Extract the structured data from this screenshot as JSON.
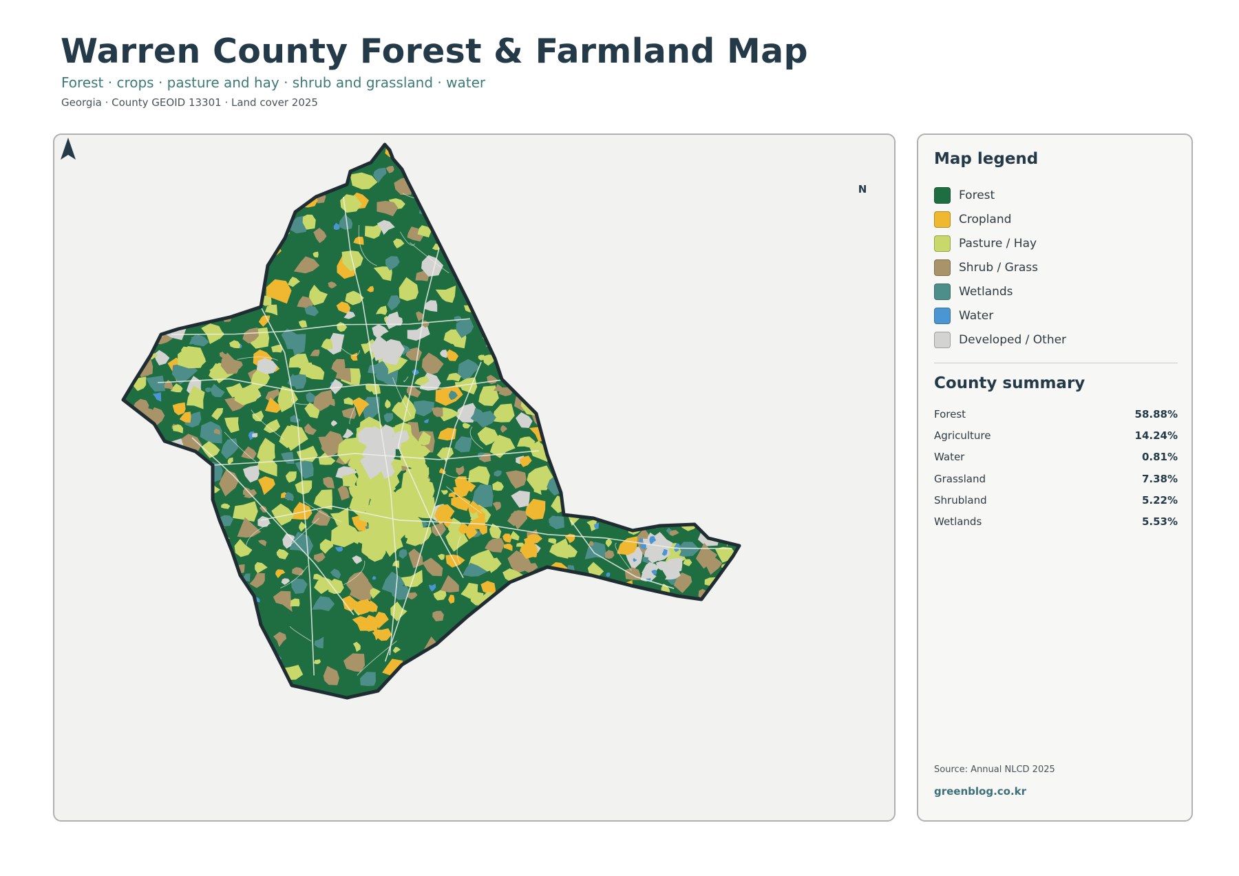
{
  "header": {
    "title": "Warren County Forest & Farmland Map",
    "subtitle": "Forest · crops · pasture and hay · shrub and grassland · water",
    "meta": "Georgia · County GEOID 13301 · Land cover 2025"
  },
  "map": {
    "north_label": "N",
    "colors": {
      "forest": "#1f6e42",
      "cropland": "#f0b731",
      "pasture": "#c9d86b",
      "shrub_grass": "#a99368",
      "wetlands": "#4e8e8a",
      "water": "#4b95d3",
      "developed": "#d3d3d1",
      "outline": "#1f2d33",
      "road": "#eef0ea"
    }
  },
  "legend": {
    "heading": "Map legend",
    "items": [
      {
        "label": "Forest",
        "color": "#1f6e42"
      },
      {
        "label": "Cropland",
        "color": "#f0b731"
      },
      {
        "label": "Pasture / Hay",
        "color": "#c9d86b"
      },
      {
        "label": "Shrub / Grass",
        "color": "#a99368"
      },
      {
        "label": "Wetlands",
        "color": "#4e8e8a"
      },
      {
        "label": "Water",
        "color": "#4b95d3"
      },
      {
        "label": "Developed / Other",
        "color": "#d3d3d1"
      }
    ]
  },
  "summary": {
    "heading": "County summary",
    "rows": [
      {
        "label": "Forest",
        "value": "58.88%"
      },
      {
        "label": "Agriculture",
        "value": "14.24%"
      },
      {
        "label": "Water",
        "value": "0.81%"
      },
      {
        "label": "Grassland",
        "value": "7.38%"
      },
      {
        "label": "Shrubland",
        "value": "5.22%"
      },
      {
        "label": "Wetlands",
        "value": "5.53%"
      }
    ]
  },
  "footer": {
    "source": "Source: Annual NLCD 2025",
    "site": "greenblog.co.kr"
  }
}
